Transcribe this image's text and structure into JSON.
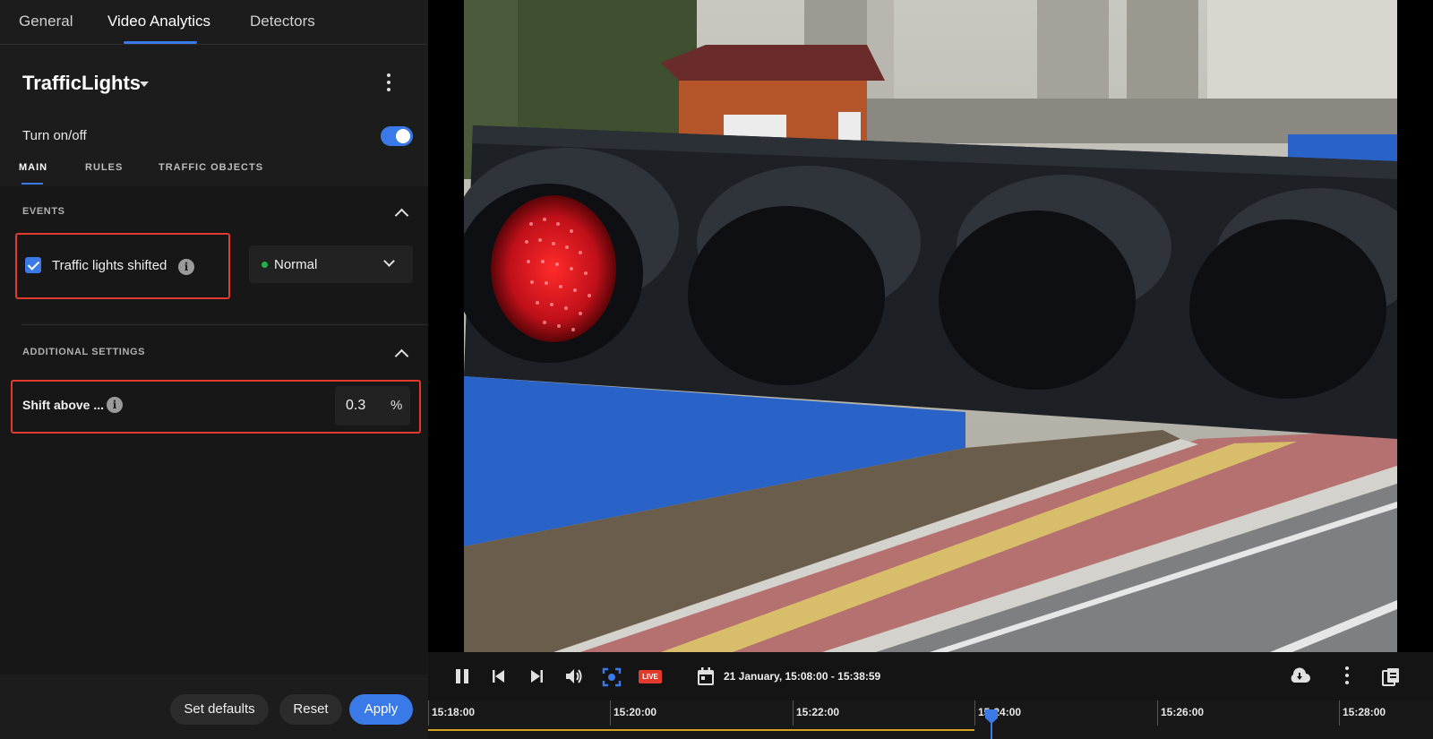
{
  "top_tabs": [
    "General",
    "Video Analytics",
    "Detectors"
  ],
  "detector": {
    "name": "TrafficLights",
    "toggle_label": "Turn on/off",
    "toggle_on": true
  },
  "sub_tabs": [
    "MAIN",
    "RULES",
    "TRAFFIC OBJECTS"
  ],
  "events": {
    "header": "EVENTS",
    "item_label": "Traffic lights shifted",
    "checked": true,
    "severity": "Normal",
    "severity_color": "#22b14c"
  },
  "additional": {
    "header": "ADDITIONAL SETTINGS",
    "shift_label": "Shift above ...",
    "shift_value": "0.3",
    "shift_unit": "%"
  },
  "footer": {
    "set_defaults": "Set defaults",
    "reset": "Reset",
    "apply": "Apply"
  },
  "player": {
    "live_label": "LIVE",
    "range": "21 January, 15:08:00 - 15:38:59",
    "icons": [
      "pause-icon",
      "skip-back-icon",
      "skip-forward-icon",
      "volume-icon",
      "fullscreen-focus-icon",
      "calendar-icon",
      "download-icon",
      "more-icon",
      "export-icon"
    ]
  },
  "timeline": {
    "ticks": [
      "15:18:00",
      "15:20:00",
      "15:22:00",
      "15:24:00",
      "15:26:00",
      "15:28:00"
    ]
  },
  "colors": {
    "accent": "#3a79e8",
    "highlight_border": "#e23b2e",
    "progress": "#d4a020"
  }
}
